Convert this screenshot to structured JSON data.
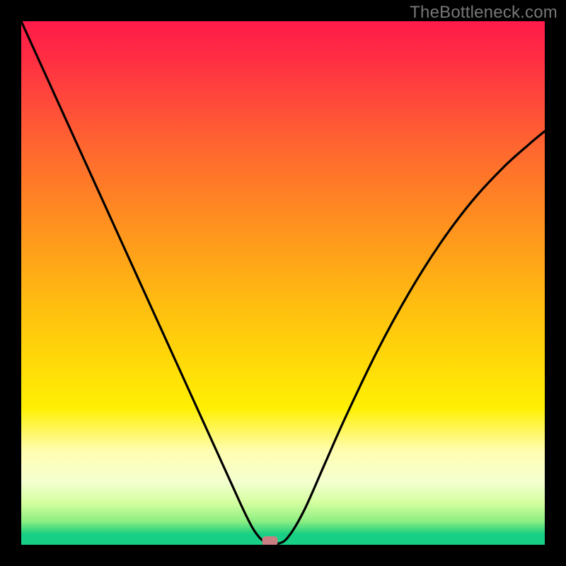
{
  "watermark": "TheBottleneck.com",
  "chart_data": {
    "type": "line",
    "title": "",
    "xlabel": "",
    "ylabel": "",
    "xlim": [
      0,
      1
    ],
    "ylim": [
      0,
      1
    ],
    "grid": false,
    "legend": false,
    "annotations": [
      {
        "name": "minimum-marker",
        "x": 0.475,
        "y": 0.0,
        "style": "rounded pink"
      }
    ],
    "background_gradient": {
      "direction": "vertical",
      "stops": [
        {
          "pos": 0.0,
          "color": "#ff1b4a"
        },
        {
          "pos": 0.25,
          "color": "#ff6a2e"
        },
        {
          "pos": 0.55,
          "color": "#ffce0c"
        },
        {
          "pos": 0.82,
          "color": "#fffdb0"
        },
        {
          "pos": 0.95,
          "color": "#8dee82"
        },
        {
          "pos": 1.0,
          "color": "#17d186"
        }
      ]
    },
    "series": [
      {
        "name": "bottleneck-curve",
        "x": [
          0.0,
          0.05,
          0.1,
          0.15,
          0.2,
          0.25,
          0.3,
          0.35,
          0.4,
          0.43,
          0.45,
          0.47,
          0.49,
          0.51,
          0.54,
          0.58,
          0.62,
          0.68,
          0.74,
          0.8,
          0.86,
          0.92,
          0.97,
          1.0
        ],
        "y": [
          1.0,
          0.89,
          0.78,
          0.67,
          0.56,
          0.45,
          0.34,
          0.23,
          0.12,
          0.055,
          0.02,
          0.002,
          0.002,
          0.015,
          0.065,
          0.155,
          0.245,
          0.37,
          0.48,
          0.575,
          0.655,
          0.72,
          0.765,
          0.79
        ]
      }
    ]
  }
}
